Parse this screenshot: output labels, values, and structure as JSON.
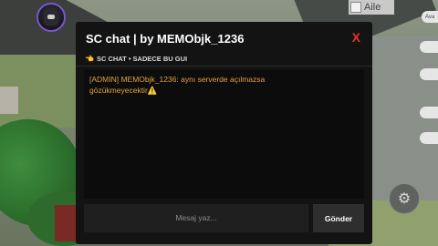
{
  "chat": {
    "title": "SC chat | by MEMObjk_1236",
    "close_label": "X",
    "subtitle": "SC CHAT • SADECE BU GUI",
    "messages": [
      {
        "text": "[ADMIN] MEMObjk_1236: aynı serverde açılmazsa gözükmeyecektir",
        "emoji": "⚠️"
      }
    ],
    "input_placeholder": "Mesaj yaz...",
    "send_label": "Gönder"
  },
  "hud": {
    "family_label": "Aile",
    "side_labels": [
      "Ava",
      "",
      "",
      "",
      ""
    ]
  },
  "colors": {
    "panel_bg": "#131313",
    "message_text": "#e1a243",
    "close": "#e2352a"
  }
}
